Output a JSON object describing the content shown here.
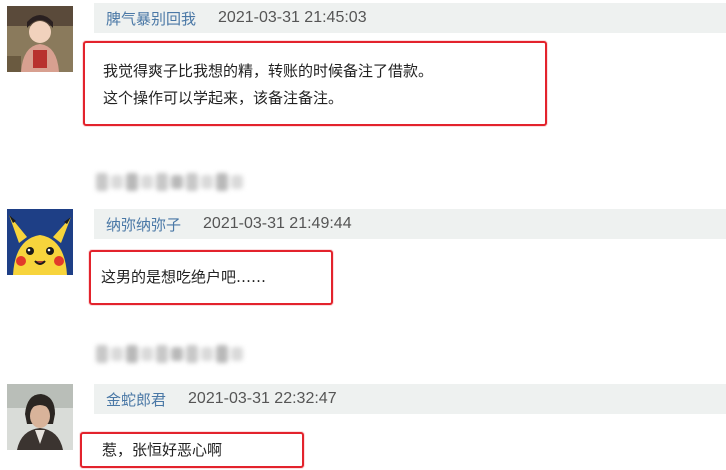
{
  "comments": [
    {
      "username": "脾气暴别回我",
      "time": "2021-03-31 21:45:03",
      "content_lines": [
        "我觉得爽子比我想的精，转账的时候备注了借款。",
        "这个操作可以学起来，该备注备注。"
      ],
      "avatar": "woman-portrait-avatar"
    },
    {
      "username": "纳弥纳弥子",
      "time": "2021-03-31 21:49:44",
      "content_lines": [
        "这男的是想吃绝户吧……"
      ],
      "avatar": "pikachu-avatar"
    },
    {
      "username": "金蛇郎君",
      "time": "2021-03-31 22:32:47",
      "content_lines": [
        "惹，张恒好恶心啊"
      ],
      "avatar": "man-portrait-avatar"
    }
  ],
  "colors": {
    "username": "#4a78a6",
    "header_bg": "#eef1f0",
    "highlight_border": "#e3232c"
  }
}
